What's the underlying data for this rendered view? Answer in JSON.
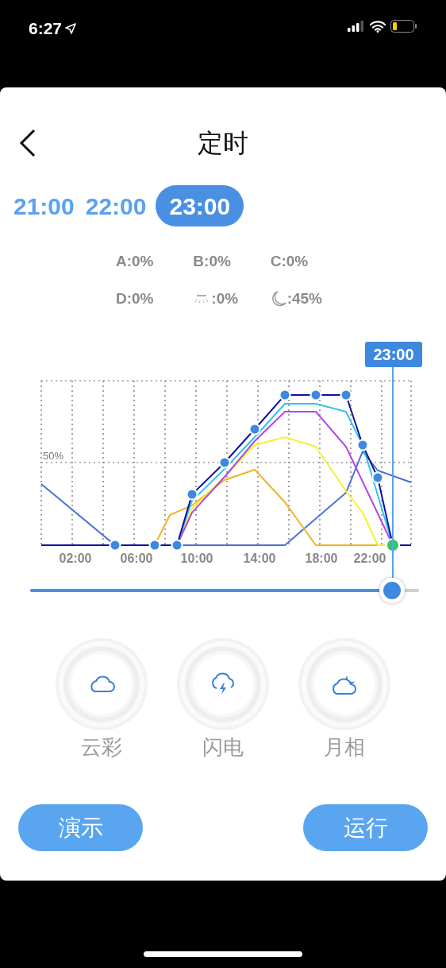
{
  "status_bar": {
    "time": "6:27"
  },
  "header": {
    "title": "定时"
  },
  "time_tabs": [
    {
      "label": "21:00",
      "selected": false
    },
    {
      "label": "22:00",
      "selected": false
    },
    {
      "label": "23:00",
      "selected": true
    }
  ],
  "readings": [
    {
      "kind": "text",
      "text": "A:0%"
    },
    {
      "kind": "text",
      "text": "B:0%"
    },
    {
      "kind": "text",
      "text": "C:0%"
    },
    {
      "kind": "text",
      "text": "D:0%"
    },
    {
      "kind": "light",
      "text": ":0%"
    },
    {
      "kind": "moon",
      "text": ":45%"
    }
  ],
  "chart": {
    "y_label": "50%",
    "x_labels": [
      "02:00",
      "06:00",
      "10:00",
      "14:00",
      "18:00",
      "22:00"
    ],
    "cursor_label": "23:00"
  },
  "slider": {
    "level": 0.93
  },
  "modes": [
    {
      "kind": "cloud",
      "label": "云彩"
    },
    {
      "kind": "lightning",
      "label": "闪电"
    },
    {
      "kind": "moon-cloud",
      "label": "月相"
    }
  ],
  "actions": [
    {
      "label": "演示"
    },
    {
      "label": "运行"
    }
  ]
}
